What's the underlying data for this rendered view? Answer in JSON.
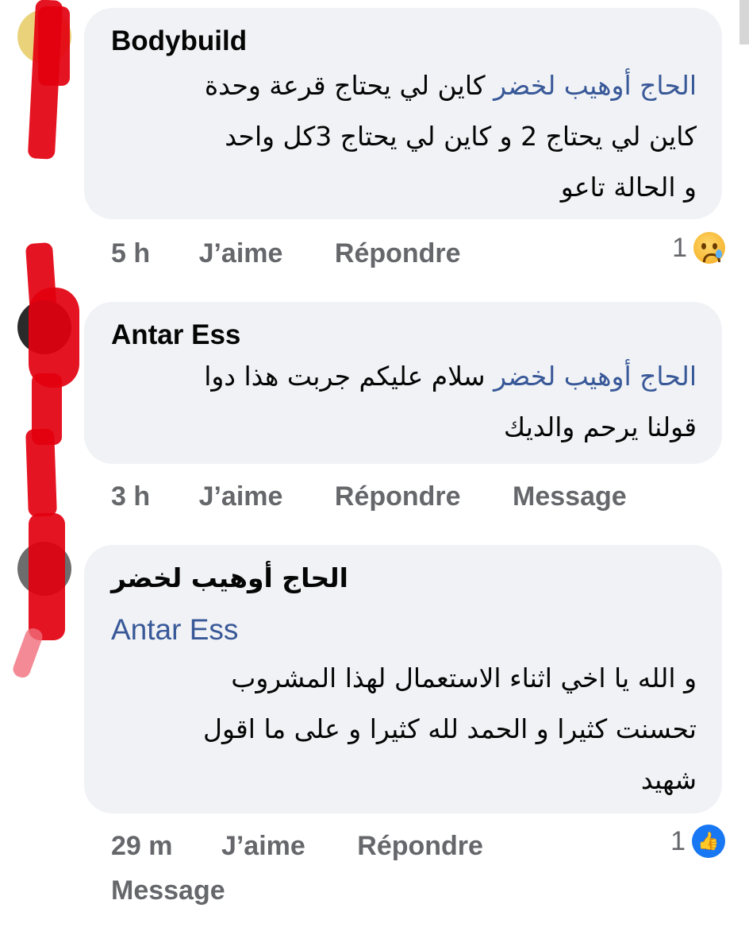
{
  "comments": [
    {
      "author": "Bodybuild",
      "mention": "الحاج أوهيب لخضر",
      "lines": [
        "كاين لي يحتاج قرعة وحدة",
        "كاين لي يحتاج 2 و كاين لي يحتاج 3كل واحد",
        "و الحالة تاعو"
      ],
      "time": "5 h",
      "like_label": "J’aime",
      "reply_label": "Répondre",
      "reaction_count": "1",
      "reaction_icon": "sad-emoji-icon"
    },
    {
      "author": "Antar Ess",
      "mention": "الحاج أوهيب لخضر",
      "lines": [
        "سلام عليكم جربت هذا دوا",
        "قولنا يرحم والديك"
      ],
      "time": "3 h",
      "like_label": "J’aime",
      "reply_label": "Répondre",
      "message_label": "Message"
    },
    {
      "author": "الحاج أوهيب لخضر",
      "mention": "Antar Ess",
      "lines": [
        "و الله يا اخي  اثناء الاستعمال لهذا المشروب",
        "تحسنت كثيرا و الحمد لله كثيرا و على ما اقول",
        "شهيد"
      ],
      "time": "29 m",
      "like_label": "J’aime",
      "reply_label": "Répondre",
      "reaction_count": "1",
      "reaction_icon": "like-thumb-icon",
      "message_label": "Message"
    }
  ],
  "colors": {
    "bubble": "#f0f2f5",
    "mention": "#385898",
    "meta": "#65676b",
    "censor": "#e3000f"
  }
}
